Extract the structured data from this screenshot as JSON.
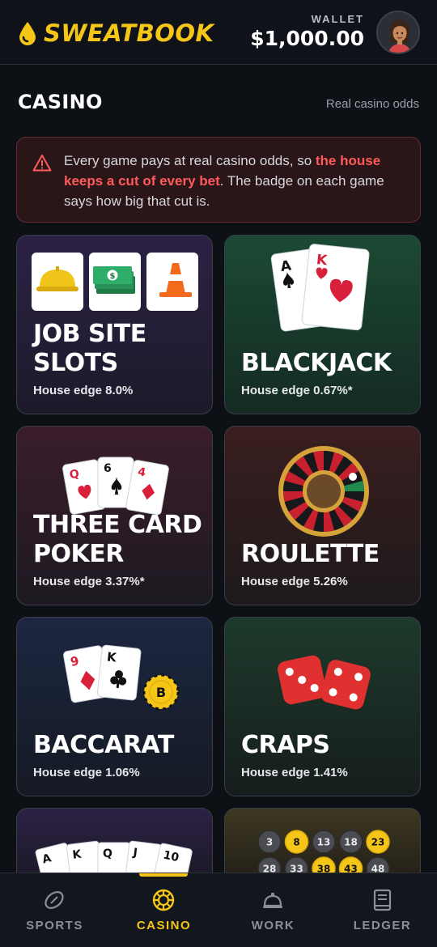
{
  "header": {
    "brand_part1": "SWEAT",
    "brand_part2": "BOOK",
    "wallet_label": "WALLET",
    "wallet_amount": "$1,000.00"
  },
  "section": {
    "title": "CASINO",
    "note": "Real casino odds"
  },
  "alert": {
    "text_before": "Every game pays at real casino odds, so ",
    "text_emphasis": "the house keeps a cut of every bet",
    "text_after": ". The badge on each game says how big that cut is."
  },
  "games": [
    {
      "name_line1": "JOB SITE",
      "name_line2": "SLOTS",
      "edge": "House edge 8.0%"
    },
    {
      "name_line1": "BLACKJACK",
      "name_line2": "",
      "edge": "House edge 0.67%*"
    },
    {
      "name_line1": "THREE CARD",
      "name_line2": "POKER",
      "edge": "House edge 3.37%*"
    },
    {
      "name_line1": "ROULETTE",
      "name_line2": "",
      "edge": "House edge 5.26%"
    },
    {
      "name_line1": "BACCARAT",
      "name_line2": "",
      "edge": "House edge 1.06%"
    },
    {
      "name_line1": "CRAPS",
      "name_line2": "",
      "edge": "House edge 1.41%"
    }
  ],
  "card_art": {
    "blackjack": [
      "A",
      "K"
    ],
    "poker": [
      "Q",
      "6",
      "4"
    ],
    "baccarat": [
      "9",
      "K"
    ],
    "baccarat_chip": "B",
    "video_poker": [
      "A",
      "K",
      "Q",
      "J",
      "10"
    ],
    "keno_row1": [
      "3",
      "8",
      "13",
      "18",
      "23"
    ],
    "keno_row2": [
      "28",
      "33",
      "38",
      "43",
      "48"
    ]
  },
  "nav": {
    "items": [
      {
        "label": "SPORTS",
        "icon": "football-icon"
      },
      {
        "label": "CASINO",
        "icon": "chip-icon"
      },
      {
        "label": "WORK",
        "icon": "bell-icon"
      },
      {
        "label": "LEDGER",
        "icon": "book-icon"
      }
    ],
    "active_index": 1
  },
  "colors": {
    "accent": "#f5c518",
    "danger": "#ff5a5a",
    "background": "#0d1015"
  }
}
